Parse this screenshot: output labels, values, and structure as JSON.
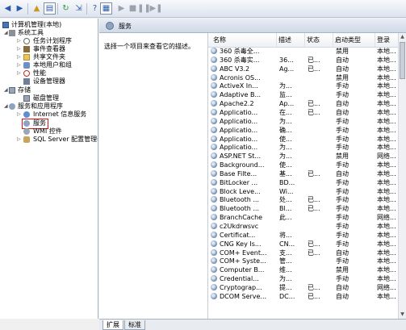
{
  "toolbar": {
    "buttons": [
      "back-icon",
      "forward-icon",
      "up-folder-icon",
      "show-hide-tree-icon",
      "refresh-icon",
      "export-icon",
      "help-icon",
      "properties-icon",
      "play-icon",
      "stop-icon",
      "pause-icon",
      "restart-icon"
    ]
  },
  "tree": {
    "root": "计算机管理(本地)",
    "system_tools": "系统工具",
    "task_scheduler": "任务计划程序",
    "event_viewer": "事件查看器",
    "shared_folders": "共享文件夹",
    "local_users": "本地用户和组",
    "performance": "性能",
    "device_manager": "设备管理器",
    "storage": "存储",
    "disk_mgmt": "磁盘管理",
    "services_apps": "服务和应用程序",
    "iis": "Internet 信息服务",
    "services": "服务",
    "wmi": "WMI 控件",
    "sql": "SQL Server 配置管理器"
  },
  "header": {
    "title": "服务"
  },
  "description_hint": "选择一个项目来查看它的描述。",
  "columns": [
    "名称",
    "描述",
    "状态",
    "启动类型",
    "登录"
  ],
  "services": [
    [
      "360 杀毒全...",
      "",
      "",
      "禁用",
      "本地..."
    ],
    [
      "360 杀毒实...",
      "36...",
      "已...",
      "自动",
      "本地..."
    ],
    [
      "ABC V3.2",
      "Ag...",
      "已...",
      "自动",
      "本地..."
    ],
    [
      "Acronis OS...",
      "",
      "",
      "禁用",
      "本地..."
    ],
    [
      "ActiveX In...",
      "为...",
      "",
      "手动",
      "本地..."
    ],
    [
      "Adaptive B...",
      "监...",
      "",
      "手动",
      "本地..."
    ],
    [
      "Apache2.2",
      "Ap...",
      "已...",
      "自动",
      "本地..."
    ],
    [
      "Applicatio...",
      "在...",
      "已...",
      "自动",
      "本地..."
    ],
    [
      "Applicatio...",
      "为...",
      "",
      "手动",
      "本地..."
    ],
    [
      "Applicatio...",
      "确...",
      "",
      "手动",
      "本地..."
    ],
    [
      "Applicatio...",
      "使...",
      "",
      "手动",
      "本地..."
    ],
    [
      "Applicatio...",
      "为...",
      "",
      "手动",
      "本地..."
    ],
    [
      "ASP.NET St...",
      "为...",
      "",
      "禁用",
      "网络..."
    ],
    [
      "Background...",
      "使...",
      "",
      "手动",
      "本地..."
    ],
    [
      "Base Filte...",
      "基...",
      "已...",
      "自动",
      "本地..."
    ],
    [
      "BitLocker ...",
      "BD...",
      "",
      "手动",
      "本地..."
    ],
    [
      "Block Leve...",
      "Wi...",
      "",
      "手动",
      "本地..."
    ],
    [
      "Bluetooth ...",
      "处...",
      "已...",
      "手动",
      "本地..."
    ],
    [
      "Bluetooth ...",
      "Bl...",
      "已...",
      "手动",
      "本地..."
    ],
    [
      "BranchCache",
      "此...",
      "",
      "手动",
      "网络..."
    ],
    [
      "c2Ukdrwsvc",
      "",
      "",
      "手动",
      "本地..."
    ],
    [
      "Certificat...",
      "将...",
      "",
      "手动",
      "本地..."
    ],
    [
      "CNG Key Is...",
      "CN...",
      "已...",
      "手动",
      "本地..."
    ],
    [
      "COM+ Event...",
      "支...",
      "已...",
      "自动",
      "本地..."
    ],
    [
      "COM+ Syste...",
      "管...",
      "",
      "手动",
      "本地..."
    ],
    [
      "Computer B...",
      "维...",
      "",
      "禁用",
      "本地..."
    ],
    [
      "Credential...",
      "为...",
      "",
      "手动",
      "本地..."
    ],
    [
      "Cryptograp...",
      "提...",
      "已...",
      "自动",
      "网络..."
    ],
    [
      "DCOM Serve...",
      "DC...",
      "已...",
      "自动",
      "本地..."
    ]
  ],
  "tabs": [
    "扩展",
    "标准"
  ]
}
